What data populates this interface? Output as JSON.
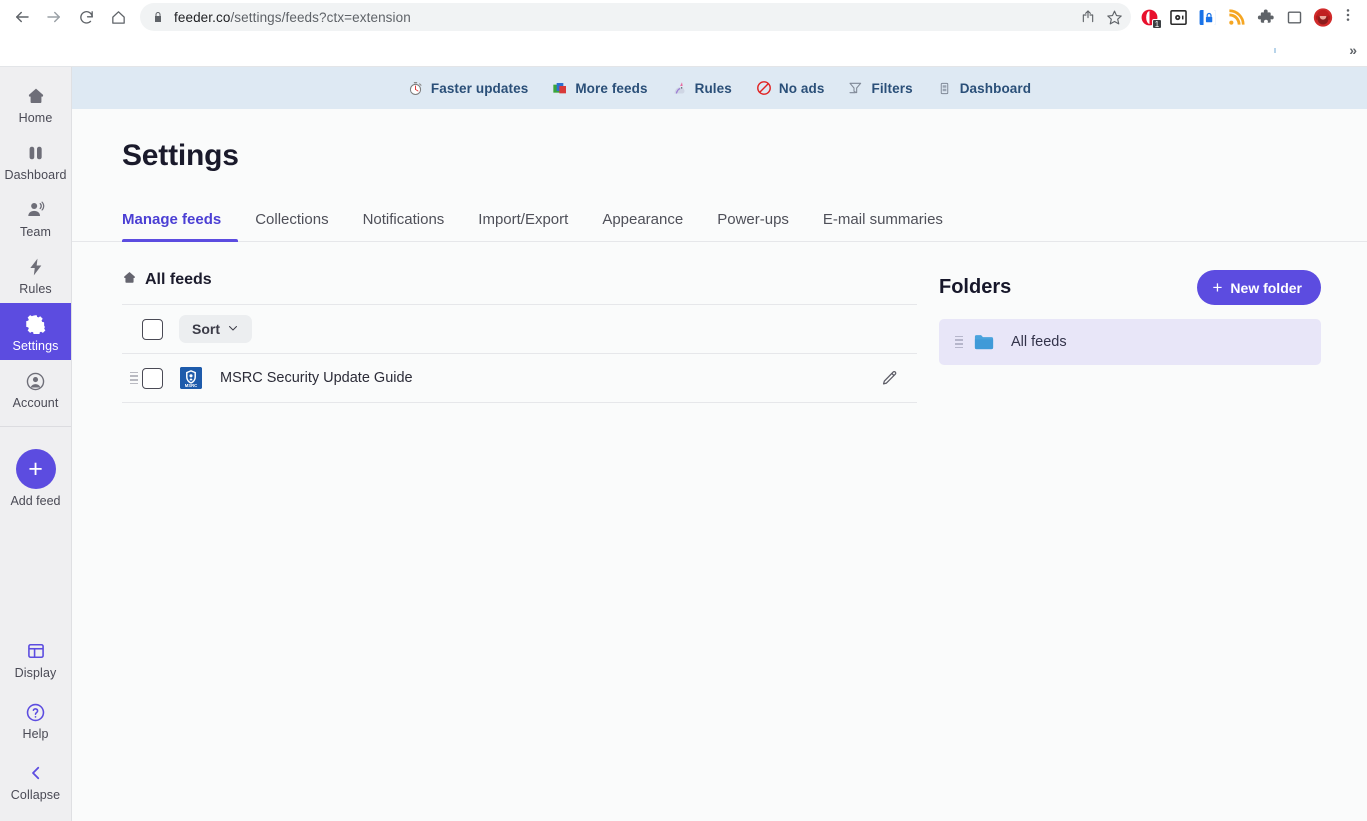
{
  "browser": {
    "back_icon": "back-arrow-icon",
    "forward_icon": "forward-arrow-icon",
    "reload_icon": "reload-icon",
    "home_icon": "home-icon",
    "lock_icon": "lock-icon",
    "url_domain": "feeder.co",
    "url_path": "/settings/feeds?ctx=extension",
    "share_icon": "share-icon",
    "bookmark_icon": "star-icon",
    "extensions": [
      {
        "name": "opera-gx-extension-icon",
        "badge": "1"
      },
      {
        "name": "safe-box-extension-icon",
        "badge": ""
      },
      {
        "name": "password-manager-extension-icon",
        "badge": ""
      },
      {
        "name": "rss-feeder-extension-icon",
        "badge": ""
      },
      {
        "name": "extensions-puzzle-icon",
        "badge": ""
      },
      {
        "name": "sidepanel-icon",
        "badge": ""
      },
      {
        "name": "profile-avatar-icon",
        "badge": ""
      }
    ],
    "menu_icon": "three-dot-menu-icon",
    "bookmark_overflow": "»"
  },
  "sidebar": {
    "items": [
      {
        "label": "Home",
        "icon": "home-icon",
        "active": false
      },
      {
        "label": "Dashboard",
        "icon": "dashboard-icon",
        "active": false
      },
      {
        "label": "Team",
        "icon": "team-icon",
        "active": false
      },
      {
        "label": "Rules",
        "icon": "lightning-bolt-icon",
        "active": false
      },
      {
        "label": "Settings",
        "icon": "gear-icon",
        "active": true
      },
      {
        "label": "Account",
        "icon": "account-circle-icon",
        "active": false
      }
    ],
    "add_feed": {
      "label": "Add feed",
      "icon": "plus-icon"
    },
    "bottom_items": [
      {
        "label": "Display",
        "icon": "display-layout-icon"
      },
      {
        "label": "Help",
        "icon": "question-mark-circle-icon"
      },
      {
        "label": "Collapse",
        "icon": "chevron-left-icon"
      }
    ]
  },
  "promo_bar": {
    "links": [
      {
        "label": "Faster updates",
        "icon": "stopwatch-icon"
      },
      {
        "label": "More feeds",
        "icon": "feeds-stack-icon"
      },
      {
        "label": "Rules",
        "icon": "unicorn-icon"
      },
      {
        "label": "No ads",
        "icon": "no-entry-icon"
      },
      {
        "label": "Filters",
        "icon": "funnel-icon"
      },
      {
        "label": "Dashboard",
        "icon": "dashboard-mini-icon"
      }
    ]
  },
  "page": {
    "title": "Settings",
    "tabs": [
      {
        "label": "Manage feeds",
        "active": true
      },
      {
        "label": "Collections",
        "active": false
      },
      {
        "label": "Notifications",
        "active": false
      },
      {
        "label": "Import/Export",
        "active": false
      },
      {
        "label": "Appearance",
        "active": false
      },
      {
        "label": "Power-ups",
        "active": false
      },
      {
        "label": "E-mail summaries",
        "active": false
      }
    ]
  },
  "feeds_panel": {
    "header_label": "All feeds",
    "header_icon": "home-icon",
    "select_all_checkbox": "",
    "sort_label": "Sort",
    "sort_chevron": "chevron-down-icon",
    "rows": [
      {
        "title": "MSRC Security Update Guide",
        "favicon_text": "MSRC",
        "drag_handle": "drag-handle-icon",
        "edit_icon": "pencil-edit-icon"
      }
    ]
  },
  "folders_panel": {
    "title": "Folders",
    "new_folder_label": "New folder",
    "new_folder_plus": "+",
    "rows": [
      {
        "name": "All feeds",
        "icon": "folder-icon",
        "selected": true
      }
    ]
  },
  "colors": {
    "accent": "#5c4ce0",
    "promo_bg": "#dee9f3",
    "promo_text": "#2a4f78",
    "folder_row_bg": "#e8e6f8",
    "rail_bg": "#efeff1",
    "page_bg": "#fafbfb"
  }
}
